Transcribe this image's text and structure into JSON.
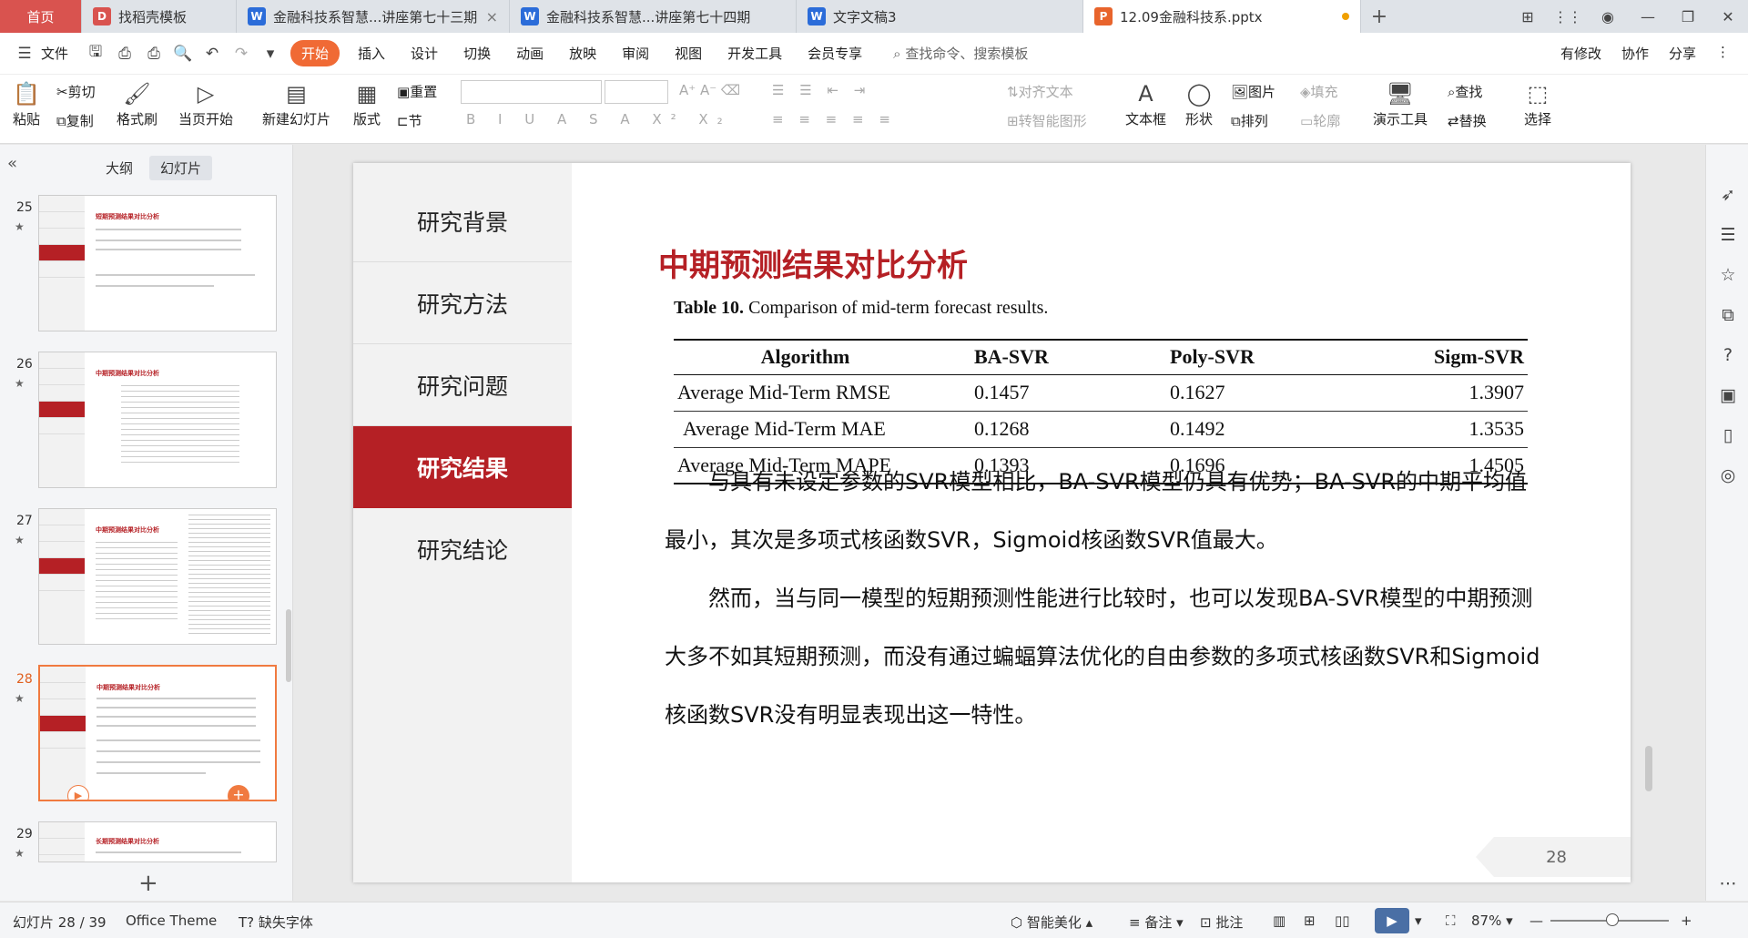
{
  "tabs": [
    {
      "label": "首页",
      "type": "home"
    },
    {
      "label": "找稻壳模板",
      "icon": "docer-icon",
      "color": "#d9534f"
    },
    {
      "label": "金融科技系智慧...讲座第七十三期",
      "icon": "wps-writer-icon",
      "color": "#2b6cd9"
    },
    {
      "label": "金融科技系智慧...讲座第七十四期",
      "icon": "wps-writer-icon",
      "color": "#2b6cd9"
    },
    {
      "label": "文字文稿3",
      "icon": "wps-writer-icon",
      "color": "#2b6cd9"
    },
    {
      "label": "12.09金融科技系.pptx",
      "icon": "wps-presentation-icon",
      "color": "#e8642c",
      "active": true
    }
  ],
  "menu": {
    "file": "文件",
    "items": [
      "开始",
      "插入",
      "设计",
      "切换",
      "动画",
      "放映",
      "审阅",
      "视图",
      "开发工具",
      "会员专享"
    ],
    "search": "查找命令、搜索模板",
    "right": [
      "有修改",
      "协作",
      "分享"
    ]
  },
  "ribbon": {
    "paste": "粘贴",
    "cut": "剪切",
    "copy": "复制",
    "format_painter": "格式刷",
    "from_current": "当页开始",
    "new_slide": "新建幻灯片",
    "layout": "版式",
    "reset": "重置",
    "section": "节",
    "align_text": "对齐文本",
    "convert_smartart": "转智能图形",
    "textbox": "文本框",
    "shapes": "形状",
    "picture": "图片",
    "arrange": "排列",
    "fill": "填充",
    "outline": "轮廓",
    "present_tools": "演示工具",
    "find": "查找",
    "replace": "替换",
    "select": "选择"
  },
  "leftpanel": {
    "view_outline": "大纲",
    "view_slides": "幻灯片",
    "thumbs": [
      {
        "num": "25",
        "title": "短期预测结果对比分析"
      },
      {
        "num": "26",
        "title": "中期预测结果对比分析"
      },
      {
        "num": "27",
        "title": "中期预测结果对比分析"
      },
      {
        "num": "28",
        "title": "中期预测结果对比分析",
        "current": true
      },
      {
        "num": "29",
        "title": "长期预测结果对比分析"
      }
    ]
  },
  "slide": {
    "nav": [
      "研究背景",
      "研究方法",
      "研究问题",
      "研究结果",
      "研究结论"
    ],
    "active_nav": "研究结果",
    "title": "中期预测结果对比分析",
    "caption_bold": "Table 10.",
    "caption_text": " Comparison of mid-term forecast results.",
    "table": {
      "headers": [
        "Algorithm",
        "BA-SVR",
        "Poly-SVR",
        "Sigm-SVR"
      ],
      "rows": [
        [
          "Average Mid-Term RMSE",
          "0.1457",
          "0.1627",
          "1.3907"
        ],
        [
          "Average Mid-Term MAE",
          "0.1268",
          "0.1492",
          "1.3535"
        ],
        [
          "Average Mid-Term MAPE",
          "0.1393",
          "0.1696",
          "1.4505"
        ]
      ]
    },
    "para1": "与具有未设定参数的SVR模型相比，BA-SVR模型仍具有优势；BA-SVR的中期平均值最小，其次是多项式核函数SVR，Sigmoid核函数SVR值最大。",
    "para2": "然而，当与同一模型的短期预测性能进行比较时，也可以发现BA-SVR模型的中期预测大多不如其短期预测，而没有通过蝙蝠算法优化的自由参数的多项式核函数SVR和Sigmoid核函数SVR没有明显表现出这一特性。",
    "page_number": "28"
  },
  "status": {
    "slide_pos": "幻灯片 28 / 39",
    "theme": "Office Theme",
    "missing_font": "缺失字体",
    "beautify": "智能美化",
    "notes": "备注",
    "comments": "批注",
    "zoom": "87%"
  },
  "colors": {
    "accent": "#b52025",
    "wps_orange": "#f06a35"
  }
}
